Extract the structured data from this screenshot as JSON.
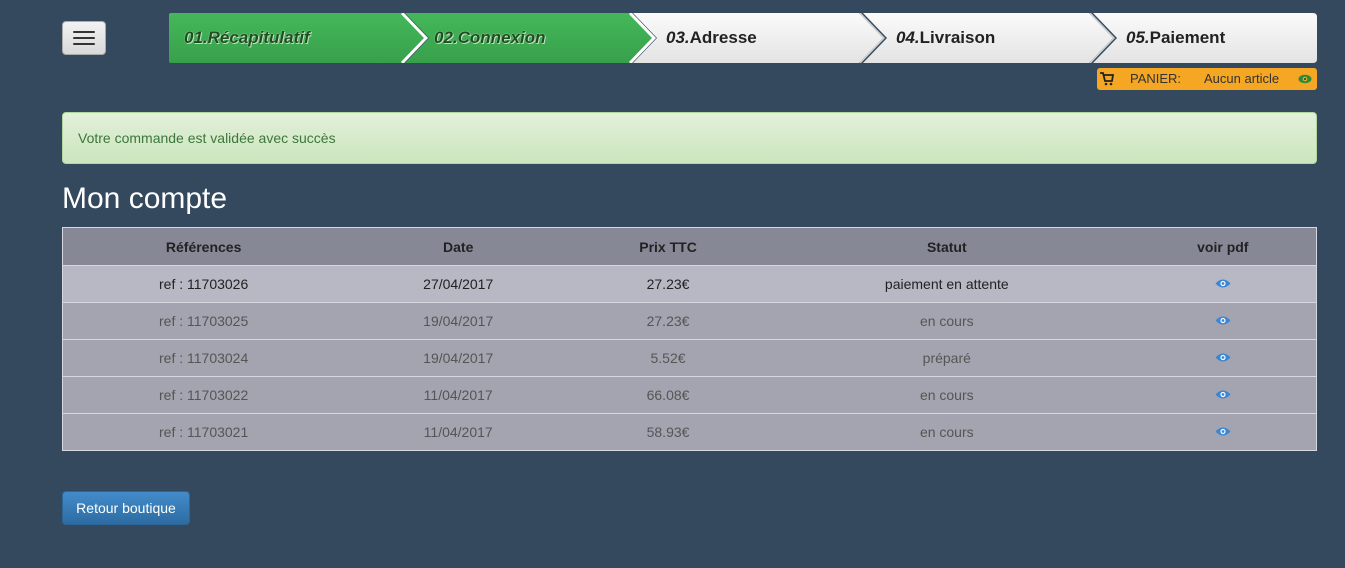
{
  "header": {
    "menu_icon": "hamburger-icon",
    "steps": [
      {
        "num": "01.",
        "label": "Récapitulatif",
        "state": "done"
      },
      {
        "num": "02.",
        "label": "Connexion",
        "state": "done"
      },
      {
        "num": "03.",
        "label": "Adresse",
        "state": "todo"
      },
      {
        "num": "04.",
        "label": "Livraison",
        "state": "todo"
      },
      {
        "num": "05.",
        "label": "Paiement",
        "state": "todo"
      }
    ],
    "cart": {
      "label": "PANIER:",
      "value": "Aucun article",
      "icon": "cart-icon",
      "view_icon": "eye-icon"
    }
  },
  "alert": {
    "message": "Votre commande est validée avec succès"
  },
  "page_title": "Mon compte",
  "orders": {
    "columns": [
      "Références",
      "Date",
      "Prix TTC",
      "Statut",
      "voir pdf"
    ],
    "rows": [
      {
        "ref": "ref : 11703026",
        "date": "27/04/2017",
        "prix": "27.23€",
        "statut": "paiement en attente"
      },
      {
        "ref": "ref : 11703025",
        "date": "19/04/2017",
        "prix": "27.23€",
        "statut": "en cours"
      },
      {
        "ref": "ref : 11703024",
        "date": "19/04/2017",
        "prix": "5.52€",
        "statut": "préparé"
      },
      {
        "ref": "ref : 11703022",
        "date": "11/04/2017",
        "prix": "66.08€",
        "statut": "en cours"
      },
      {
        "ref": "ref : 11703021",
        "date": "11/04/2017",
        "prix": "58.93€",
        "statut": "en cours"
      }
    ]
  },
  "back_button": "Retour boutique",
  "colors": {
    "background": "#34495e",
    "step_done": "#40b054",
    "cart": "#f5a623",
    "primary": "#428bca"
  }
}
